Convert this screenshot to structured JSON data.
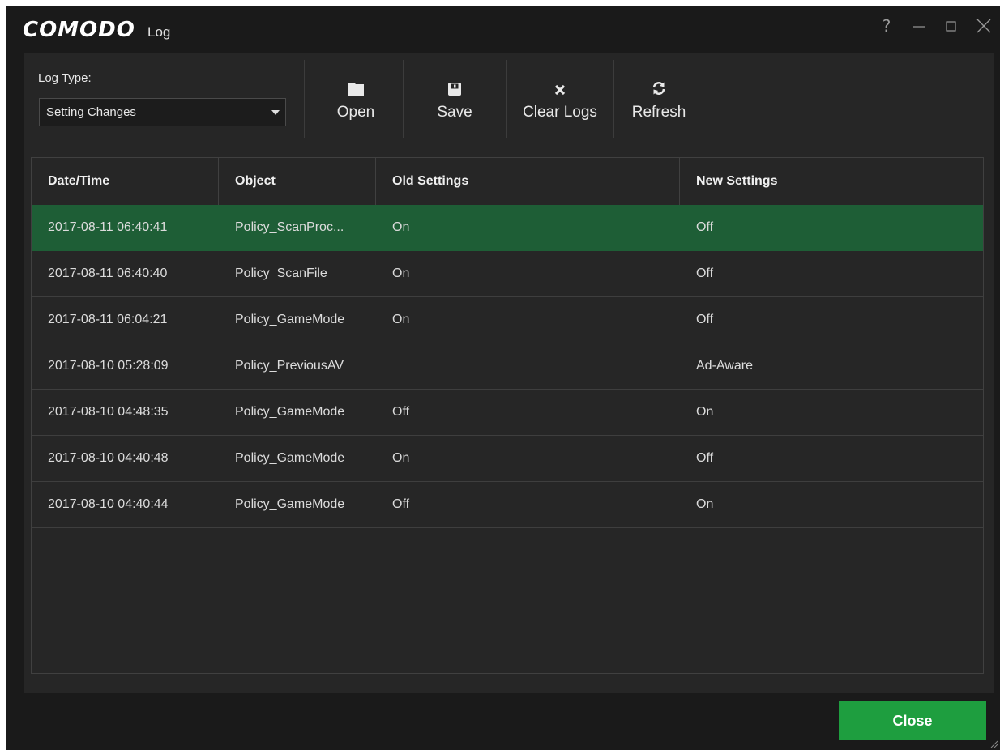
{
  "window": {
    "logo": "COMODO",
    "title": "Log",
    "controls": {
      "help": "?",
      "minimize": "minimize",
      "maximize": "maximize",
      "close": "close"
    }
  },
  "toolbar": {
    "log_type_label": "Log Type:",
    "log_type_value": "Setting Changes",
    "buttons": {
      "open": {
        "label": "Open",
        "icon": "folder-icon"
      },
      "save": {
        "label": "Save",
        "icon": "floppy-disk-icon"
      },
      "clear": {
        "label": "Clear Logs",
        "icon": "x-icon"
      },
      "refresh": {
        "label": "Refresh",
        "icon": "refresh-icon"
      }
    }
  },
  "table": {
    "columns": [
      "Date/Time",
      "Object",
      "Old Settings",
      "New Settings"
    ],
    "selected_row": 0,
    "rows": [
      [
        "2017-08-11 06:40:41",
        "Policy_ScanProc...",
        "On",
        "Off"
      ],
      [
        "2017-08-11 06:40:40",
        "Policy_ScanFile",
        "On",
        "Off"
      ],
      [
        "2017-08-11 06:04:21",
        "Policy_GameMode",
        "On",
        "Off"
      ],
      [
        "2017-08-10 05:28:09",
        "Policy_PreviousAV",
        "",
        "Ad-Aware"
      ],
      [
        "2017-08-10 04:48:35",
        "Policy_GameMode",
        "Off",
        "On"
      ],
      [
        "2017-08-10 04:40:48",
        "Policy_GameMode",
        "On",
        "Off"
      ],
      [
        "2017-08-10 04:40:44",
        "Policy_GameMode",
        "Off",
        "On"
      ]
    ]
  },
  "footer": {
    "close_label": "Close"
  },
  "colors": {
    "window_bg": "#1a1a1a",
    "panel_bg": "#262626",
    "selected_row": "#1e5e36",
    "close_button": "#1e9e3f"
  }
}
